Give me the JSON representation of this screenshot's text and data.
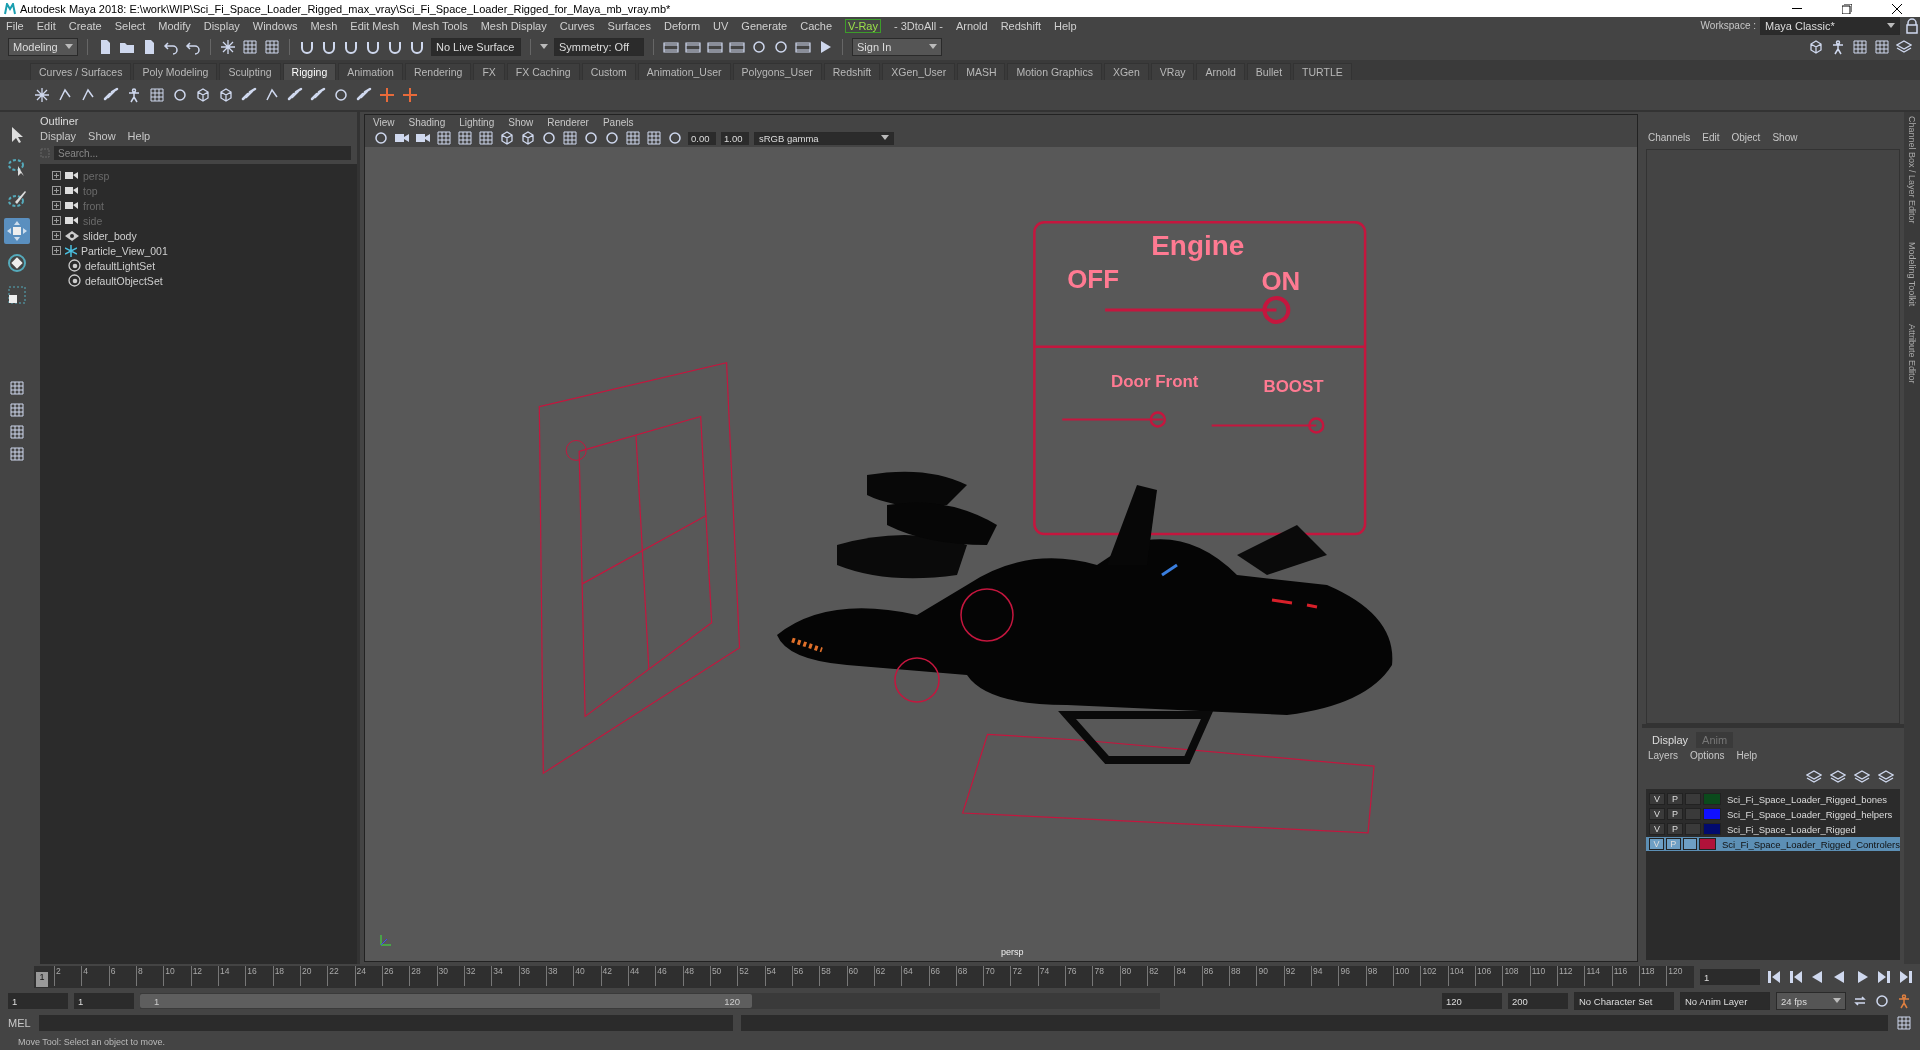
{
  "window": {
    "title": "Autodesk Maya 2018: E:\\work\\WIP\\Sci_Fi_Space_Loader_Rigged_max_vray\\Sci_Fi_Space_Loader_Rigged_for_Maya_mb_vray.mb*"
  },
  "menu": [
    {
      "label": "File",
      "boxed": false
    },
    {
      "label": "Edit",
      "boxed": false
    },
    {
      "label": "Create",
      "boxed": false
    },
    {
      "label": "Select",
      "boxed": false
    },
    {
      "label": "Modify",
      "boxed": false
    },
    {
      "label": "Display",
      "boxed": false
    },
    {
      "label": "Windows",
      "boxed": false
    },
    {
      "label": "Mesh",
      "boxed": false
    },
    {
      "label": "Edit Mesh",
      "boxed": false
    },
    {
      "label": "Mesh Tools",
      "boxed": false
    },
    {
      "label": "Mesh Display",
      "boxed": false
    },
    {
      "label": "Curves",
      "boxed": false
    },
    {
      "label": "Surfaces",
      "boxed": false
    },
    {
      "label": "Deform",
      "boxed": false
    },
    {
      "label": "UV",
      "boxed": false
    },
    {
      "label": "Generate",
      "boxed": false
    },
    {
      "label": "Cache",
      "boxed": false
    },
    {
      "label": "V-Ray",
      "boxed": true
    },
    {
      "label": "- 3DtoAll -",
      "boxed": false
    },
    {
      "label": "Arnold",
      "boxed": false
    },
    {
      "label": "Redshift",
      "boxed": false
    },
    {
      "label": "Help",
      "boxed": false
    }
  ],
  "workspace": {
    "label": "Workspace :",
    "value": "Maya Classic*"
  },
  "status_line": {
    "mode": "Modeling",
    "live_surface": "No Live Surface",
    "symmetry": "Symmetry: Off",
    "sign_in": "Sign In"
  },
  "shelf_tabs": [
    {
      "label": "Curves / Surfaces",
      "selected": false
    },
    {
      "label": "Poly Modeling",
      "selected": false
    },
    {
      "label": "Sculpting",
      "selected": false
    },
    {
      "label": "Rigging",
      "selected": true
    },
    {
      "label": "Animation",
      "selected": false
    },
    {
      "label": "Rendering",
      "selected": false
    },
    {
      "label": "FX",
      "selected": false
    },
    {
      "label": "FX Caching",
      "selected": false
    },
    {
      "label": "Custom",
      "selected": false
    },
    {
      "label": "Animation_User",
      "selected": false
    },
    {
      "label": "Polygons_User",
      "selected": false
    },
    {
      "label": "Redshift",
      "selected": false
    },
    {
      "label": "XGen_User",
      "selected": false
    },
    {
      "label": "MASH",
      "selected": false
    },
    {
      "label": "Motion Graphics",
      "selected": false
    },
    {
      "label": "XGen",
      "selected": false
    },
    {
      "label": "VRay",
      "selected": false
    },
    {
      "label": "Arnold",
      "selected": false
    },
    {
      "label": "Bullet",
      "selected": false
    },
    {
      "label": "TURTLE",
      "selected": false
    }
  ],
  "toolbox": [
    {
      "kind": "select",
      "selected": false
    },
    {
      "kind": "lasso",
      "selected": false
    },
    {
      "kind": "paint",
      "selected": false
    },
    {
      "kind": "move",
      "selected": true
    },
    {
      "kind": "rotate",
      "selected": false
    },
    {
      "kind": "scale",
      "selected": false
    }
  ],
  "outliner": {
    "title": "Outliner",
    "menu": [
      "Display",
      "Show",
      "Help"
    ],
    "search_placeholder": "Search...",
    "items": [
      {
        "label": "persp",
        "kind": "camera",
        "dimmed": true,
        "expandable": true
      },
      {
        "label": "top",
        "kind": "camera",
        "dimmed": true,
        "expandable": true
      },
      {
        "label": "front",
        "kind": "camera",
        "dimmed": true,
        "expandable": true
      },
      {
        "label": "side",
        "kind": "camera",
        "dimmed": true,
        "expandable": true
      },
      {
        "label": "slider_body",
        "kind": "group",
        "dimmed": false,
        "expandable": true
      },
      {
        "label": "Particle_View_001",
        "kind": "particle",
        "dimmed": false,
        "expandable": true
      },
      {
        "label": "defaultLightSet",
        "kind": "set",
        "dimmed": false,
        "expandable": false
      },
      {
        "label": "defaultObjectSet",
        "kind": "set",
        "dimmed": false,
        "expandable": false
      }
    ]
  },
  "viewport": {
    "menu": [
      "View",
      "Shading",
      "Lighting",
      "Show",
      "Renderer",
      "Panels"
    ],
    "exposure": "0.00",
    "gamma": "1.00",
    "color_space": "sRGB gamma",
    "camera": "persp",
    "controls_panel": {
      "title": "Engine",
      "off_label": "OFF",
      "on_label": "ON",
      "engine_slider": {
        "level": 1
      },
      "sliders": [
        {
          "label": "Door Front",
          "level": 0.95
        },
        {
          "label": "BOOST",
          "level": 1
        }
      ]
    }
  },
  "channel_box": {
    "menu": [
      "Channels",
      "Edit",
      "Object",
      "Show"
    ]
  },
  "layer_editor": {
    "tabs": [
      {
        "label": "Display",
        "selected": true
      },
      {
        "label": "Anim",
        "selected": false
      }
    ],
    "menu": [
      "Layers",
      "Options",
      "Help"
    ],
    "layers": [
      {
        "v": "V",
        "p": "P",
        "name": "Sci_Fi_Space_Loader_Rigged_bones",
        "color": "#0b4a1c",
        "selected": false
      },
      {
        "v": "V",
        "p": "P",
        "name": "Sci_Fi_Space_Loader_Rigged_helpers",
        "color": "#1010ff",
        "selected": false
      },
      {
        "v": "V",
        "p": "P",
        "name": "Sci_Fi_Space_Loader_Rigged",
        "color": "#020a6e",
        "selected": false
      },
      {
        "v": "V",
        "p": "P",
        "name": "Sci_Fi_Space_Loader_Rigged_Controlers",
        "color": "#b0123a",
        "selected": true
      }
    ]
  },
  "side_tabs": [
    "Channel Box / Layer Editor",
    "Modeling Toolkit",
    "Attribute Editor"
  ],
  "timeline": {
    "current": "1",
    "level": 0,
    "ticks": [
      "2",
      "4",
      "6",
      "8",
      "10",
      "12",
      "14",
      "16",
      "18",
      "20",
      "22",
      "24",
      "26",
      "28",
      "30",
      "32",
      "34",
      "36",
      "38",
      "40",
      "42",
      "44",
      "46",
      "48",
      "50",
      "52",
      "54",
      "56",
      "58",
      "60",
      "62",
      "64",
      "66",
      "68",
      "70",
      "72",
      "74",
      "76",
      "78",
      "80",
      "82",
      "84",
      "86",
      "88",
      "90",
      "92",
      "94",
      "96",
      "98",
      "100",
      "102",
      "104",
      "106",
      "108",
      "110",
      "112",
      "114",
      "116",
      "118",
      "120"
    ],
    "frame_field": "1"
  },
  "range": {
    "level": 0.6,
    "start": "1",
    "playback_start": "1",
    "slider_start": "1",
    "slider_end": "120",
    "playback_end": "120",
    "end": "200",
    "character_set": "No Character Set",
    "anim_layer": "No Anim Layer",
    "fps": "24 fps"
  },
  "command_line": {
    "label": "MEL"
  },
  "help_line": "Move Tool: Select an object to move."
}
